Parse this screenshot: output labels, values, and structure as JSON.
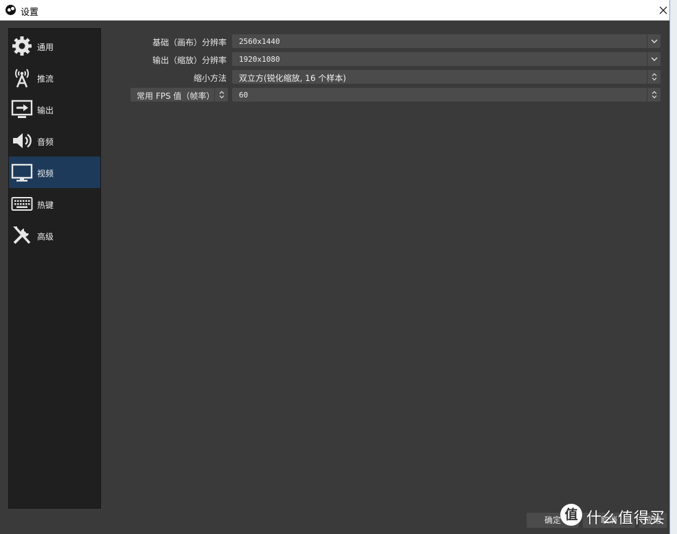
{
  "window": {
    "title": "设置"
  },
  "sidebar": {
    "items": [
      {
        "label": "通用",
        "icon": "gear-icon"
      },
      {
        "label": "推流",
        "icon": "broadcast-antenna-icon"
      },
      {
        "label": "输出",
        "icon": "output-monitor-icon"
      },
      {
        "label": "音频",
        "icon": "speaker-icon"
      },
      {
        "label": "视频",
        "icon": "monitor-icon",
        "active": true
      },
      {
        "label": "热键",
        "icon": "keyboard-icon"
      },
      {
        "label": "高级",
        "icon": "tools-icon"
      }
    ]
  },
  "video": {
    "base_resolution": {
      "label": "基础（画布）分辨率",
      "value": "2560x1440"
    },
    "output_resolution": {
      "label": "输出（缩放）分辨率",
      "value": "1920x1080"
    },
    "downscale_filter": {
      "label": "缩小方法",
      "value": "双立方(锐化缩放, 16 个样本)"
    },
    "fps": {
      "type_label": "常用 FPS 值（帧率）",
      "value": "60"
    }
  },
  "buttons": {
    "ok": "确定",
    "cancel": "取消",
    "apply": "应用"
  },
  "watermark": {
    "logo_char": "值",
    "text": "什么值得买"
  },
  "colors": {
    "background": "#3a3a3a",
    "sidebar": "#1f1f1f",
    "active_item": "#1e3a5a",
    "field": "#4b4b4b",
    "titlebar": "#ffffff"
  }
}
